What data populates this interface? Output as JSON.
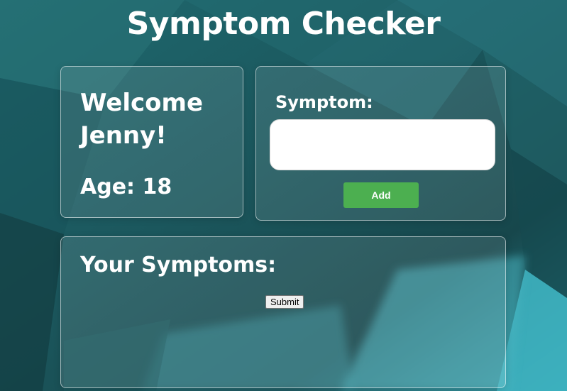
{
  "page": {
    "title": "Symptom Checker",
    "colors": {
      "background_dark": "#123f44",
      "background_mid": "#1d6369",
      "background_light": "#3fb6c4",
      "add_button": "#4caf50",
      "text": "#ffffff"
    }
  },
  "profile": {
    "welcome_text": "Welcome Jenny!",
    "age_text": "Age: 18"
  },
  "symptom_form": {
    "label": "Symptom:",
    "input_value": "",
    "add_label": "Add"
  },
  "symptoms": {
    "heading": "Your Symptoms:",
    "items": [],
    "submit_label": "Submit"
  }
}
